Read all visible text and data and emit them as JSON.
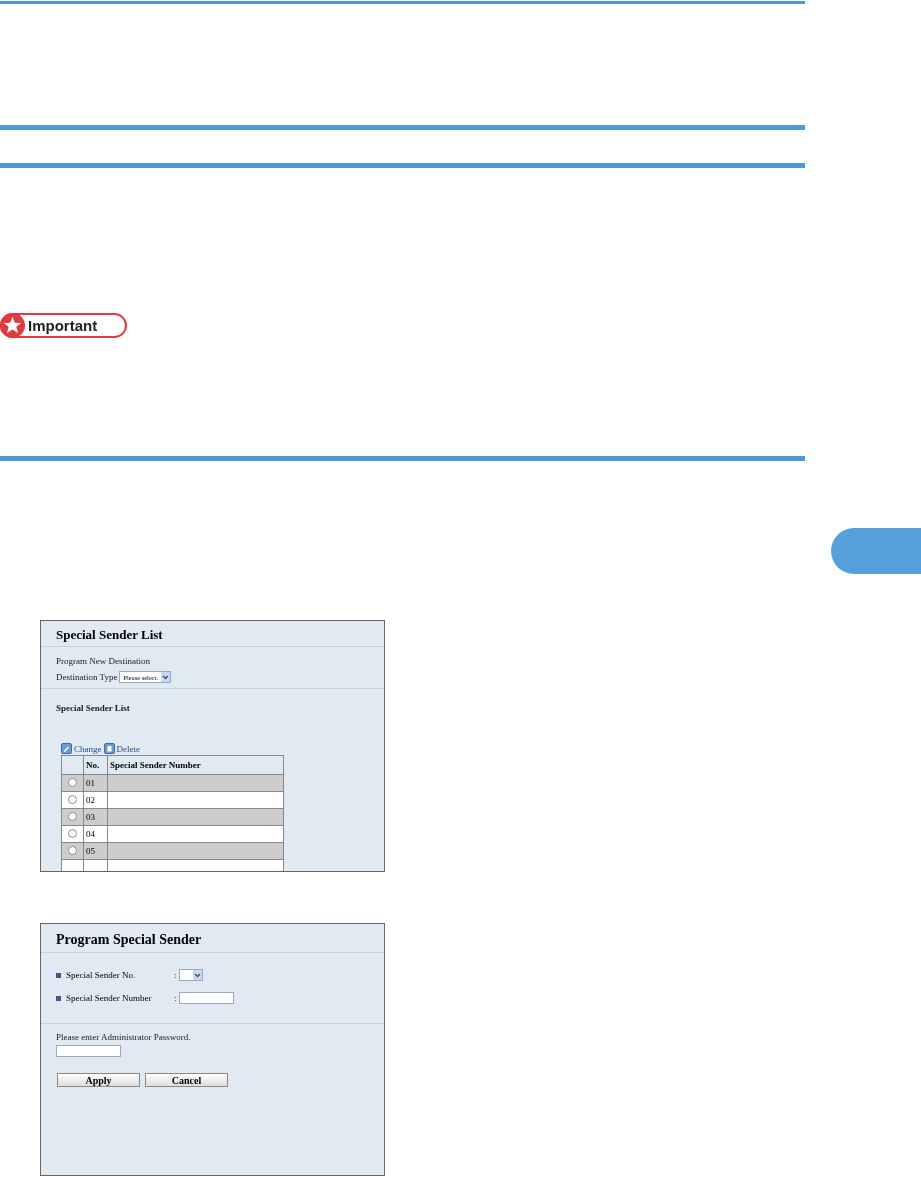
{
  "important_badge": {
    "label": "Important"
  },
  "list_screen": {
    "title": "Special Sender List",
    "program_label": "Program New Destination",
    "destination_type": {
      "label": "Destination Type",
      "value": "Please select."
    },
    "section_title": "Special Sender List",
    "toolbar": [
      "Change",
      "Delete"
    ],
    "table": {
      "columns": [
        "No.",
        "Special Sender Number"
      ],
      "rows": [
        {
          "no": "01",
          "selected": false
        },
        {
          "no": "02",
          "selected": false
        },
        {
          "no": "03",
          "selected": false
        },
        {
          "no": "04",
          "selected": false
        },
        {
          "no": "05",
          "selected": false
        }
      ]
    }
  },
  "form_screen": {
    "title": "Program Special Sender",
    "fields": [
      {
        "label": "Special Sender No.",
        "separator": ":",
        "kind": "select"
      },
      {
        "label": "Special Sender Number",
        "separator": ":",
        "kind": "text"
      }
    ],
    "password_prompt": "Please enter Administrator Password.",
    "buttons": [
      "Apply",
      "Cancel"
    ]
  }
}
